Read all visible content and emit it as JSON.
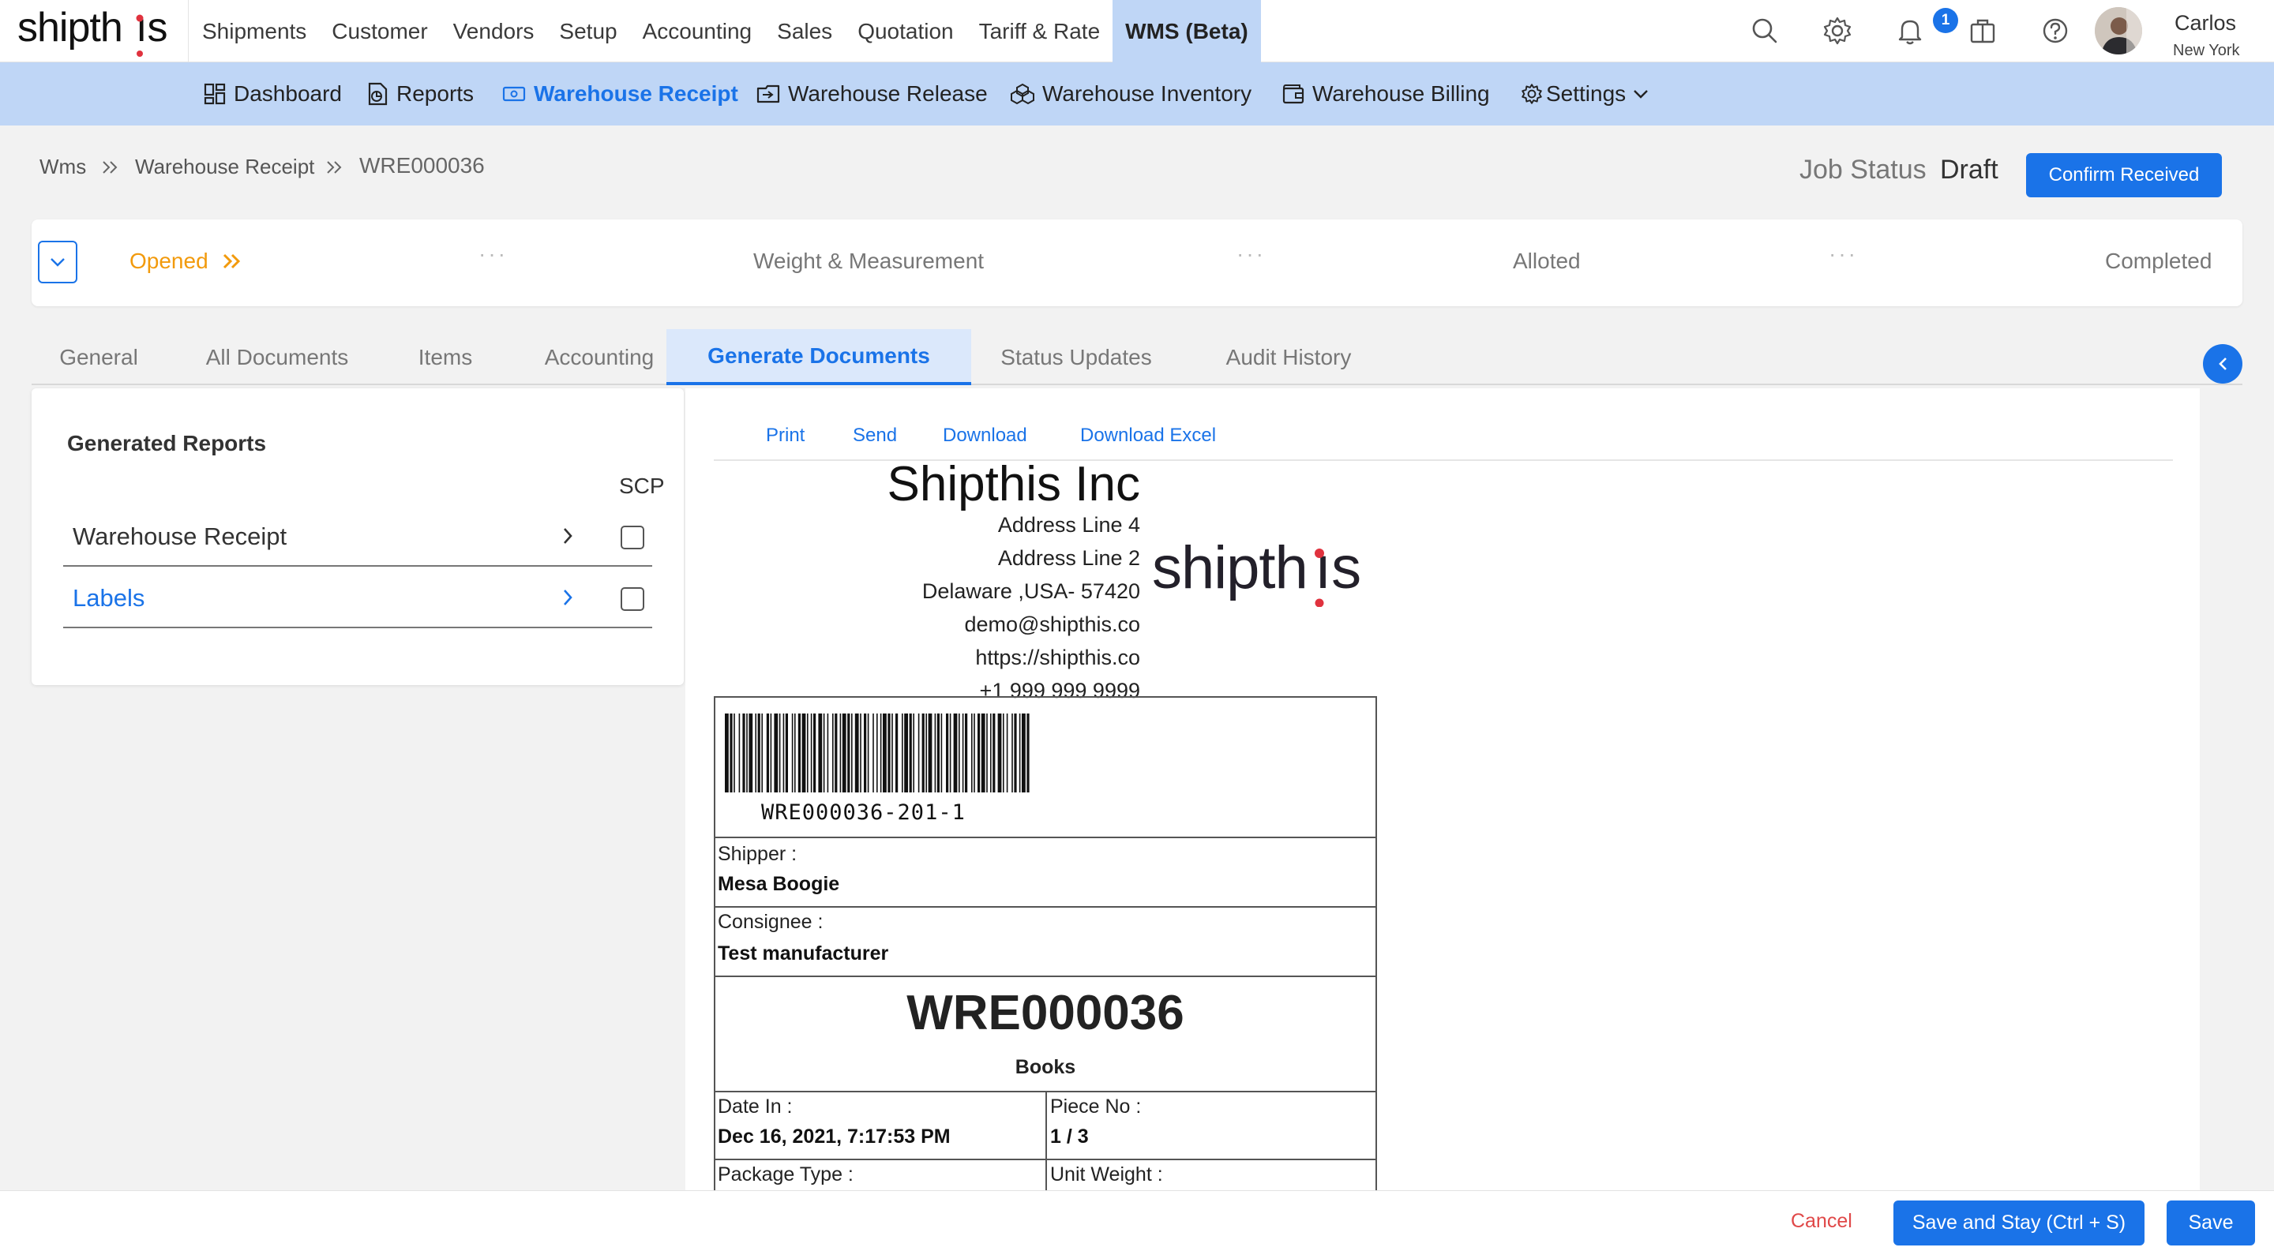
{
  "brand": {
    "name": "shipthis",
    "accent": "#e0323e"
  },
  "nav": {
    "items": [
      "Shipments",
      "Customer",
      "Vendors",
      "Setup",
      "Accounting",
      "Sales",
      "Quotation",
      "Tariff & Rate",
      "WMS (Beta)"
    ],
    "active": "WMS (Beta)",
    "icons": [
      "search-icon",
      "gear-icon",
      "bell-icon",
      "briefcase-icon",
      "help-icon"
    ],
    "notification_count": "1",
    "user": {
      "name": "Carlos",
      "location": "New York"
    }
  },
  "subnav": {
    "items": [
      "Dashboard",
      "Reports",
      "Warehouse Receipt",
      "Warehouse Release",
      "Warehouse Inventory",
      "Warehouse Billing",
      "Settings"
    ],
    "active": "Warehouse Receipt"
  },
  "breadcrumb": [
    "Wms",
    "Warehouse Receipt",
    "WRE000036"
  ],
  "header": {
    "job_status_label": "Job Status",
    "job_status_value": "Draft",
    "confirm_button": "Confirm Received"
  },
  "stepper": {
    "steps": [
      "Opened",
      "Weight & Measurement",
      "Alloted",
      "Completed"
    ],
    "active": "Opened"
  },
  "tabs": {
    "items": [
      "General",
      "All Documents",
      "Items",
      "Accounting",
      "Generate Documents",
      "Status Updates",
      "Audit History"
    ],
    "active": "Generate Documents"
  },
  "reports": {
    "title": "Generated Reports",
    "column": "SCP",
    "items": [
      {
        "label": "Warehouse Receipt",
        "checked": false
      },
      {
        "label": "Labels",
        "checked": false
      }
    ]
  },
  "preview": {
    "actions": [
      "Print",
      "Send",
      "Download",
      "Download Excel"
    ],
    "company": {
      "name": "Shipthis Inc",
      "lines": [
        "Address Line 4",
        "Address Line 2",
        "Delaware ,USA- 57420",
        "demo@shipthis.co",
        "https://shipthis.co",
        "+1 999 999 9999"
      ]
    },
    "barcode_text": "WRE000036-201-1",
    "shipper_label": "Shipper :",
    "shipper": "Mesa Boogie",
    "consignee_label": "Consignee :",
    "consignee": "Test manufacturer",
    "receipt_no": "WRE000036",
    "commodity": "Books",
    "date_in_label": "Date In :",
    "date_in": "Dec 16, 2021, 7:17:53 PM",
    "piece_no_label": "Piece No :",
    "piece_no": "1 / 3",
    "package_type_label": "Package Type :",
    "unit_weight_label": "Unit Weight :"
  },
  "footer": {
    "cancel": "Cancel",
    "save_stay": "Save and Stay (Ctrl + S)",
    "save": "Save"
  },
  "colors": {
    "primary": "#1a73e8",
    "nav_active_bg": "#bfd6f6",
    "step_active": "#f29a0c",
    "cancel": "#e04848"
  }
}
